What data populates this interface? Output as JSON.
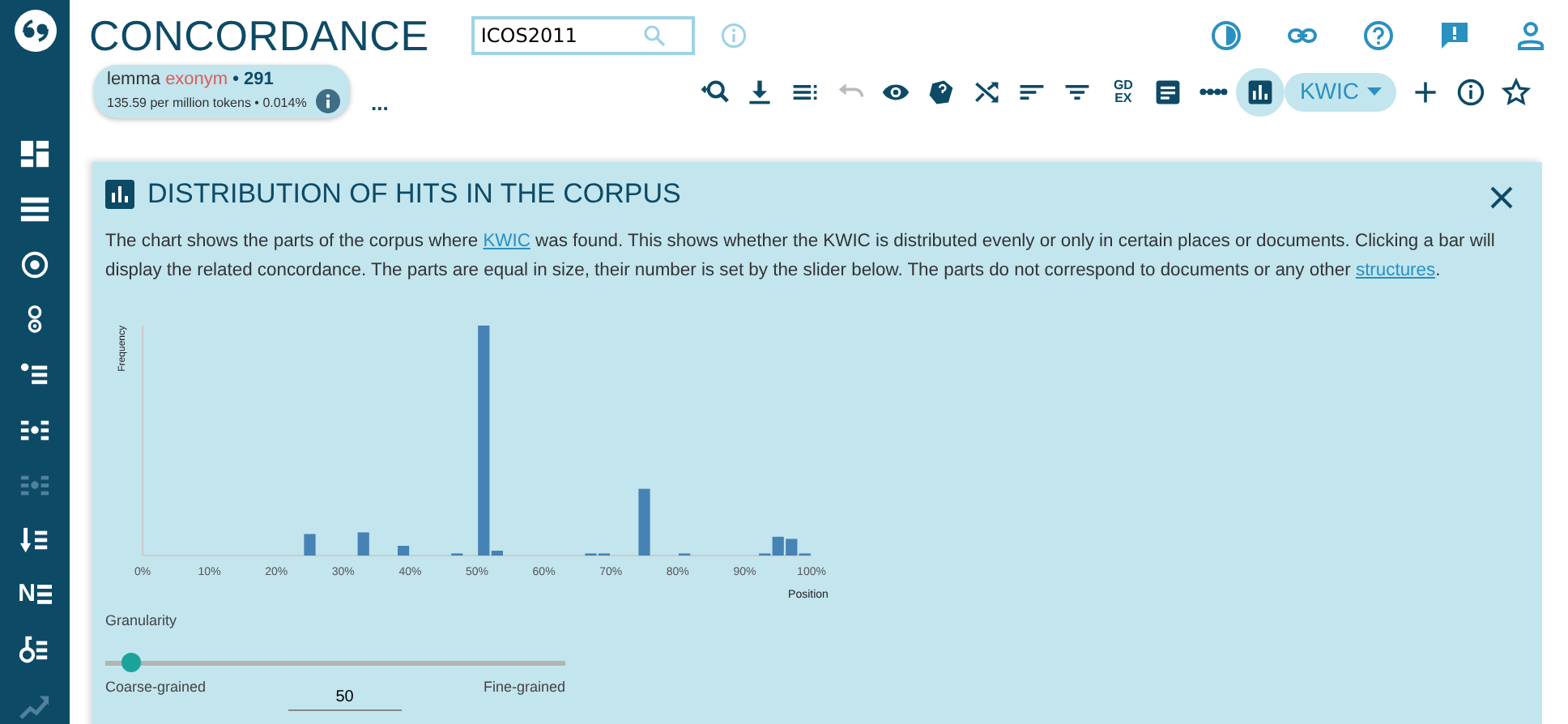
{
  "app": {
    "title": "CONCORDANCE"
  },
  "search": {
    "value": "ICOS2011"
  },
  "header_icons": [
    {
      "kind": "theme"
    },
    {
      "kind": "link"
    },
    {
      "kind": "help"
    },
    {
      "kind": "feedback"
    },
    {
      "kind": "user"
    }
  ],
  "sidebar": {
    "items": [
      {
        "kind": "dashboard",
        "disabled": false
      },
      {
        "kind": "list",
        "disabled": false
      },
      {
        "kind": "target",
        "disabled": false
      },
      {
        "kind": "double",
        "disabled": false
      },
      {
        "kind": "bulletlist",
        "disabled": false
      },
      {
        "kind": "split",
        "disabled": false
      },
      {
        "kind": "split",
        "disabled": true
      },
      {
        "kind": "sortdown",
        "disabled": false
      },
      {
        "kind": "ne",
        "label": "N",
        "disabled": false
      },
      {
        "kind": "keylist",
        "disabled": false
      },
      {
        "kind": "trend",
        "disabled": true
      }
    ]
  },
  "query": {
    "attribute": "lemma",
    "term": "exonym",
    "hits": "• 291",
    "frequency": "135.59 per million tokens",
    "percent": "• 0.014%"
  },
  "more": "...",
  "toolbar": [
    {
      "kind": "zoom",
      "disabled": false,
      "selected": false
    },
    {
      "kind": "download",
      "disabled": false,
      "selected": false
    },
    {
      "kind": "lines",
      "disabled": false,
      "selected": false
    },
    {
      "kind": "undo",
      "disabled": true,
      "selected": false
    },
    {
      "kind": "eye",
      "disabled": false,
      "selected": false
    },
    {
      "kind": "cube",
      "disabled": false,
      "selected": false
    },
    {
      "kind": "shuffle",
      "disabled": false,
      "selected": false
    },
    {
      "kind": "sort",
      "disabled": false,
      "selected": false
    },
    {
      "kind": "filter",
      "disabled": false,
      "selected": false
    },
    {
      "kind": "text",
      "label": "GD EX",
      "disabled": false,
      "selected": false
    },
    {
      "kind": "doc",
      "disabled": false,
      "selected": false
    },
    {
      "kind": "dots",
      "disabled": false,
      "selected": false
    },
    {
      "kind": "chart",
      "disabled": false,
      "selected": true
    },
    {
      "kind": "dropdown",
      "label": "KWIC",
      "disabled": false,
      "selected": false
    },
    {
      "kind": "plus",
      "disabled": false,
      "selected": false
    },
    {
      "kind": "info",
      "disabled": false,
      "selected": false
    },
    {
      "kind": "star",
      "disabled": false,
      "selected": false
    }
  ],
  "panel": {
    "title": "DISTRIBUTION OF HITS IN THE CORPUS",
    "description": [
      {
        "text": "The chart shows the parts of the corpus where ",
        "link": false
      },
      {
        "text": "KWIC",
        "link": true
      },
      {
        "text": " was found. This shows whether the KWIC is distributed evenly or only in certain places or documents. Clicking a bar will display the related concordance. The parts are equal in size, their number is set by the slider below. The parts do not correspond to documents or any other ",
        "link": false
      },
      {
        "text": "structures",
        "link": true
      },
      {
        "text": ".",
        "link": false
      }
    ],
    "chart": {
      "ylabel": "Frequency",
      "xlabel": "Position",
      "xticks": [
        "0%",
        "10%",
        "20%",
        "30%",
        "40%",
        "50%",
        "60%",
        "70%",
        "80%",
        "90%",
        "100%"
      ]
    },
    "granularity": {
      "label": "Granularity",
      "level": 0.056,
      "min_label": "Coarse-grained",
      "max_label": "Fine-grained",
      "value": "50"
    }
  }
}
